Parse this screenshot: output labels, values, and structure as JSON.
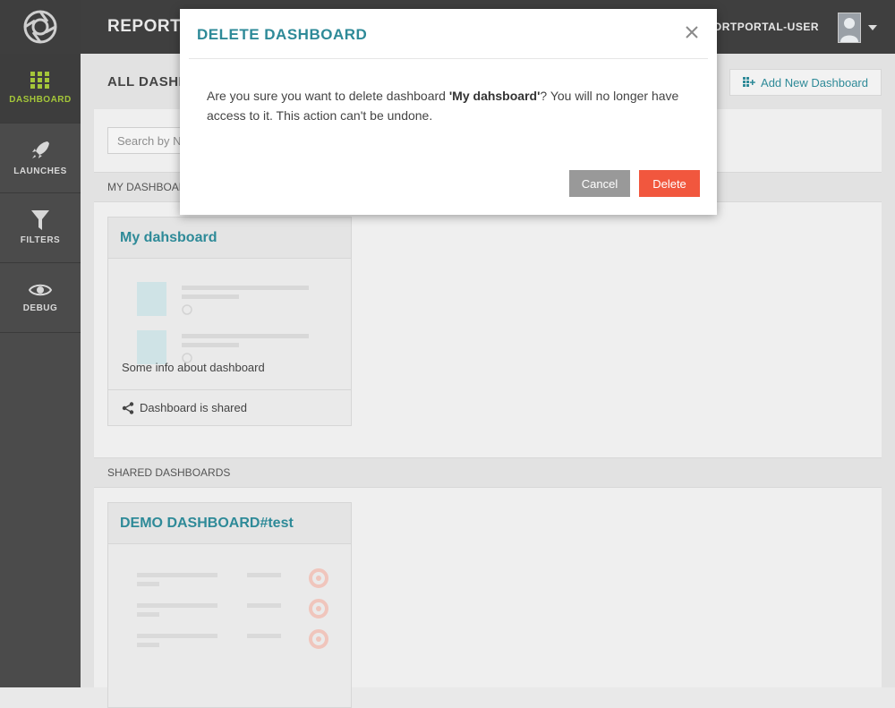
{
  "sidebar": {
    "items": [
      {
        "label": "DASHBOARD",
        "icon": "grid-icon",
        "active": true
      },
      {
        "label": "LAUNCHES",
        "icon": "rocket-icon",
        "active": false
      },
      {
        "label": "FILTERS",
        "icon": "filter-icon",
        "active": false
      },
      {
        "label": "DEBUG",
        "icon": "eye-icon",
        "active": false
      }
    ]
  },
  "header": {
    "brand": "REPORTPO",
    "user": "REPORTPORTAL-USER"
  },
  "main": {
    "title": "ALL DASHB",
    "add_button": "Add New Dashboard",
    "search_placeholder": "Search by N",
    "my_section": "MY DASHBOAR",
    "shared_section": "SHARED DASHBOARDS",
    "my_card": {
      "title": "My dahsboard",
      "info": "Some info about dashboard",
      "footer": "Dashboard is shared"
    },
    "shared_card": {
      "title": "DEMO DASHBOARD#test"
    }
  },
  "modal": {
    "title": "DELETE DASHBOARD",
    "text_before": "Are you sure you want to delete dashboard ",
    "dashboard_name": "'My dahsboard'",
    "text_after": "? You will no longer have access to it. This action can't be undone.",
    "cancel_label": "Cancel",
    "delete_label": "Delete"
  },
  "colors": {
    "accent": "#2e8a98",
    "danger": "#f1573e",
    "active_nav": "#a4c639"
  }
}
